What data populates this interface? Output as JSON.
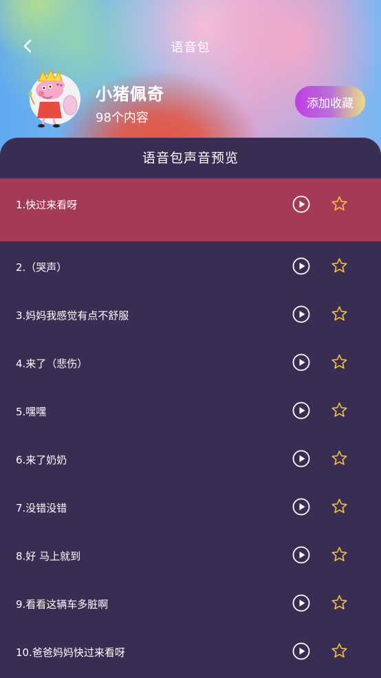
{
  "header": {
    "title": "语音包",
    "back_icon": "chevron-left-icon"
  },
  "pack": {
    "name": "小猪佩奇",
    "count": "98个内容",
    "favorite_label": "添加收藏",
    "avatar": "peppa-pig-avatar"
  },
  "panel": {
    "title": "语音包声音预览"
  },
  "tracks": [
    {
      "label": "1.快过来看呀",
      "active": true
    },
    {
      "label": "2.（哭声）",
      "active": false
    },
    {
      "label": "3.妈妈我感觉有点不舒服",
      "active": false
    },
    {
      "label": "4.来了（悲伤）",
      "active": false
    },
    {
      "label": "5.嘿嘿",
      "active": false
    },
    {
      "label": "6.来了奶奶",
      "active": false
    },
    {
      "label": "7.没错没错",
      "active": false
    },
    {
      "label": "8.好 马上就到",
      "active": false
    },
    {
      "label": "9.看看这辆车多脏啊",
      "active": false
    },
    {
      "label": "10.爸爸妈妈快过来看呀",
      "active": false
    }
  ],
  "colors": {
    "panel_bg": "#392d54",
    "active_row": "#a43a55",
    "star": "#f5c23b",
    "button_gradient_start": "#c23ce6",
    "button_gradient_end": "#ece083"
  },
  "icons": {
    "play": "play-circle-icon",
    "favorite": "star-outline-icon"
  }
}
